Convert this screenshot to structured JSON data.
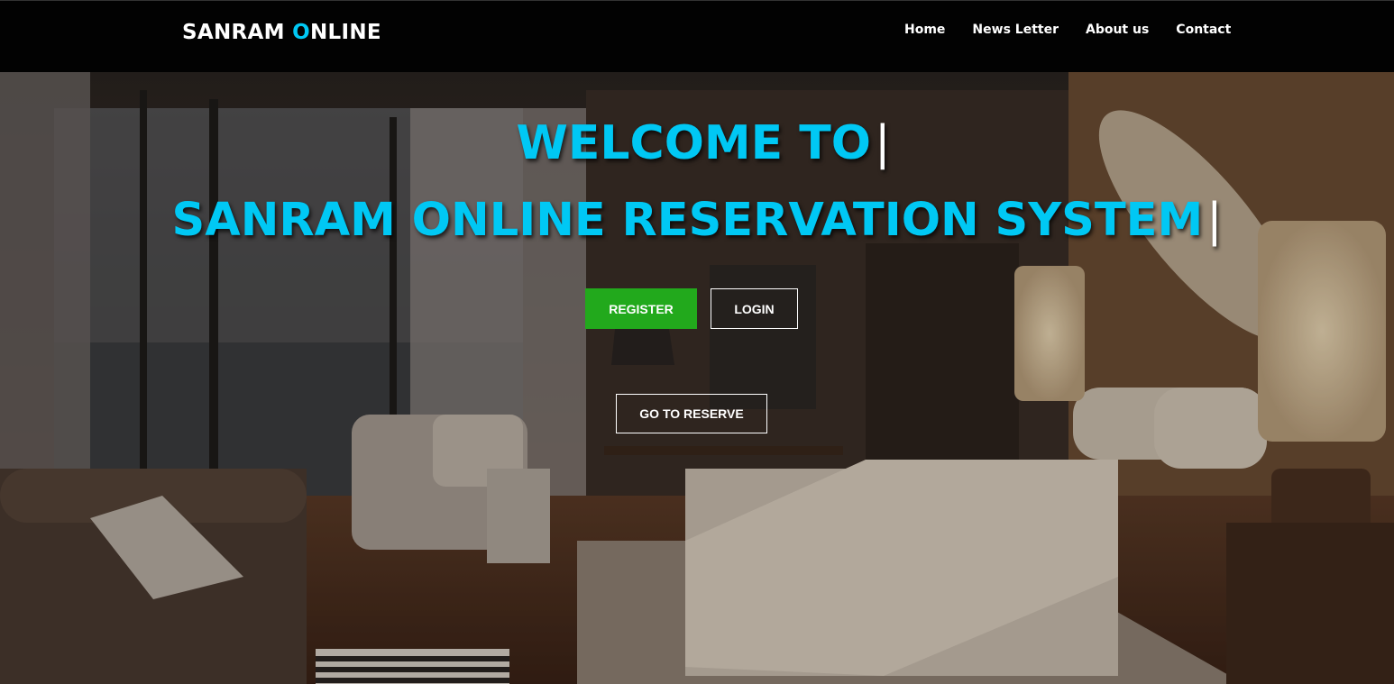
{
  "brand": {
    "prefix": "SANRAM ",
    "accent_letter": "O",
    "suffix": "NLINE"
  },
  "nav": {
    "items": [
      {
        "label": "Home"
      },
      {
        "label": "News Letter"
      },
      {
        "label": "About us"
      },
      {
        "label": "Contact"
      }
    ]
  },
  "hero": {
    "line1": "WELCOME TO",
    "line2": "SANRAM ONLINE RESERVATION SYSTEM",
    "caret": "|",
    "register_label": "REGISTER",
    "login_label": "LOGIN",
    "reserve_label": "GO TO RESERVE"
  },
  "colors": {
    "accent": "#00c8f4",
    "register_green": "#22a91c",
    "navbar_bg": "#020202"
  }
}
